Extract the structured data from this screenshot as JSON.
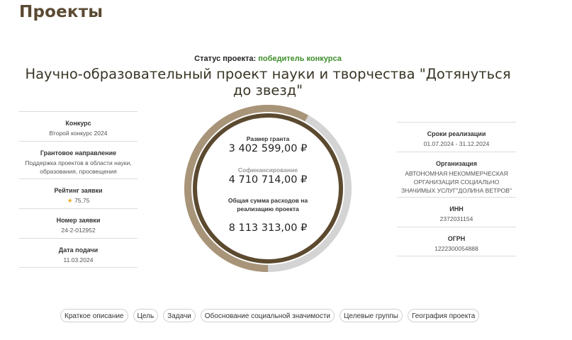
{
  "page": {
    "heading": "Проекты"
  },
  "status": {
    "label": "Статус проекта:",
    "value": "победитель конкурса",
    "color": "#3e8e2b"
  },
  "project": {
    "title": "Научно-образовательный проект науки и творчества \"Дотянуться до звезд\""
  },
  "left_info": [
    {
      "label": "Конкурс",
      "value": "Второй конкурс 2024"
    },
    {
      "label": "Грантовое направление",
      "value": "Поддержка проектов в области науки, образования, просвещения"
    },
    {
      "label": "Рейтинг заявки",
      "value": "75,75",
      "icon": "star-icon"
    },
    {
      "label": "Номер заявки",
      "value": "24-2-012952"
    },
    {
      "label": "Дата подачи",
      "value": "11.03.2024"
    }
  ],
  "right_info": [
    {
      "label": "Сроки реализации",
      "value": "01.07.2024 - 31.12.2024"
    },
    {
      "label": "Организация",
      "value": "АВТОНОМНАЯ НЕКОММЕРЧЕСКАЯ ОРГАНИЗАЦИЯ СОЦИАЛЬНО ЗНАЧИМЫХ УСЛУГ\"ДОЛИНА ВЕТРОВ\""
    },
    {
      "label": "ИНН",
      "value": "2372031154"
    },
    {
      "label": "ОГРН",
      "value": "1222300054888"
    }
  ],
  "finance": {
    "grant_label": "Размер гранта",
    "grant_amount": "3 402 599,00 ₽",
    "cofinancing_label": "Софинансирование",
    "cofinancing_amount": "4 710 714,00 ₽",
    "total_label": "Общая сумма расходов на реализацию проекта",
    "total_amount": "8 113 313,00 ₽",
    "cofinancing_share": 0.58,
    "colors": {
      "grant": "#5c4a30",
      "cofinancing": "#a89478",
      "track": "#d4d4d4"
    }
  },
  "tabs": [
    "Краткое описание",
    "Цель",
    "Задачи",
    "Обоснование социальной значимости",
    "Целевые группы",
    "География проекта"
  ]
}
